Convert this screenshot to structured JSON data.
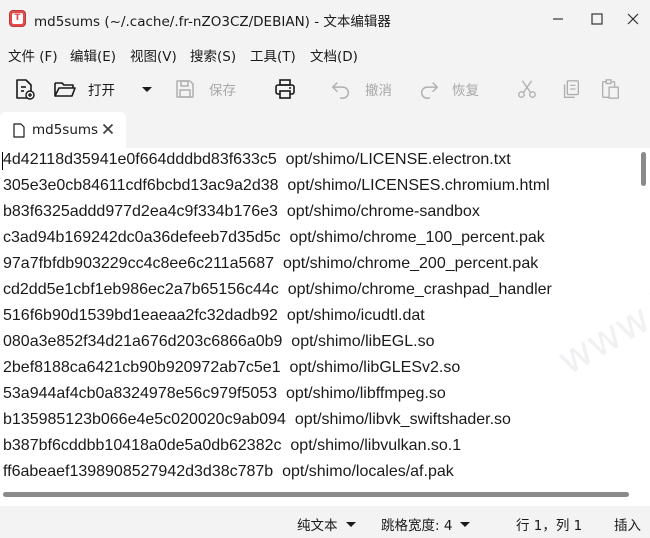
{
  "window": {
    "title": "md5sums (~/.cache/.fr-nZO3CZ/DEBIAN) - 文本编辑器",
    "app_icon_letter": "T"
  },
  "menu": [
    {
      "label": "文件 (F)"
    },
    {
      "label": "编辑(E)"
    },
    {
      "label": "视图(V)"
    },
    {
      "label": "搜索(S)"
    },
    {
      "label": "工具(T)"
    },
    {
      "label": "文档(D)"
    }
  ],
  "toolbar": {
    "open_label": "打开",
    "save_label": "保存",
    "undo_label": "撤消",
    "redo_label": "恢复"
  },
  "tabs": [
    {
      "label": "md5sums"
    }
  ],
  "editor": {
    "lines": [
      "4d42118d35941e0f664dddbd83f633c5  opt/shimo/LICENSE.electron.txt",
      "305e3e0cb84611cdf6bcbd13ac9a2d38  opt/shimo/LICENSES.chromium.html",
      "b83f6325addd977d2ea4c9f334b176e3  opt/shimo/chrome-sandbox",
      "c3ad94b169242dc0a36defeeb7d35d5c  opt/shimo/chrome_100_percent.pak",
      "97a7fbfdb903229cc4c8ee6c211a5687  opt/shimo/chrome_200_percent.pak",
      "cd2dd5e1cbf1eb986ec2a7b65156c44c  opt/shimo/chrome_crashpad_handler",
      "516f6b90d1539bd1eaeaa2fc32dadb92  opt/shimo/icudtl.dat",
      "080a3e852f34d21a676d203c6866a0b9  opt/shimo/libEGL.so",
      "2bef8188ca6421cb90b920972ab7c5e1  opt/shimo/libGLESv2.so",
      "53a944af4cb0a8324978e56c979f5053  opt/shimo/libffmpeg.so",
      "b135985123b066e4e5c020020c9ab094  opt/shimo/libvk_swiftshader.so",
      "b387bf6cddbb10418a0de5a0db62382c  opt/shimo/libvulkan.so.1",
      "ff6abeaef1398908527942d3d38c787b  opt/shimo/locales/af.pak"
    ]
  },
  "statusbar": {
    "syntax": "纯文本",
    "tab_width": "跳格宽度: 4",
    "position": "行 1，列 1",
    "mode": "插入"
  },
  "watermark": "www.iigeek.com",
  "colors": {
    "chrome_bg": "#f3f3f3",
    "editor_bg": "#ffffff",
    "disabled_text": "#a8a8a8",
    "app_icon": "#e04a4a"
  }
}
